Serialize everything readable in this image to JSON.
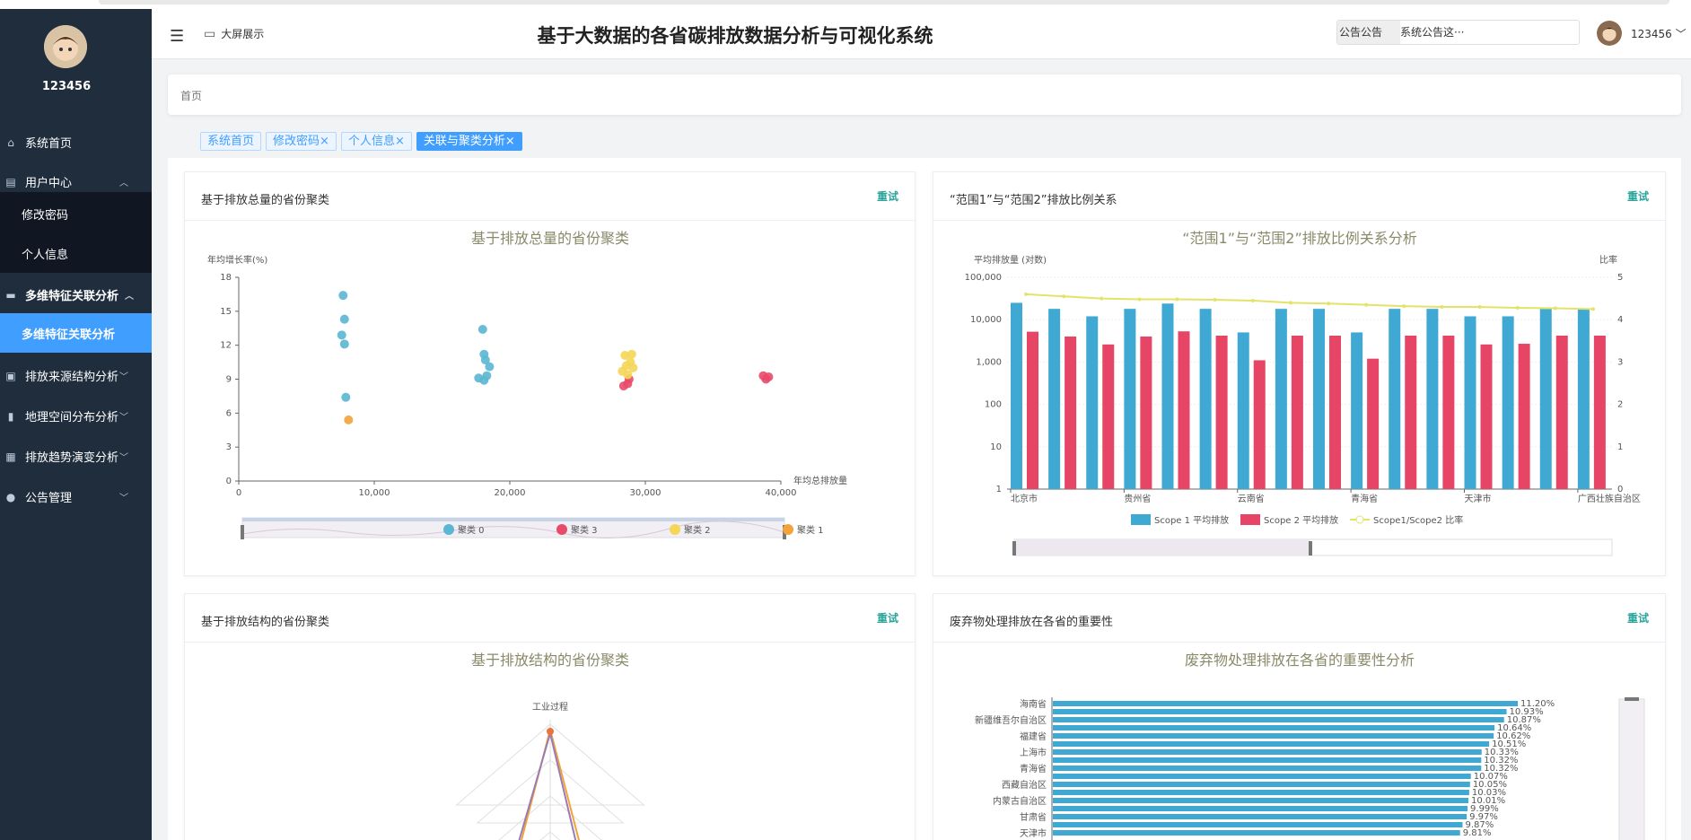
{
  "header": {
    "bigscreen_label": "大屏展示",
    "title": "基于大数据的各省碳排放数据分析与可视化系统",
    "notice_label": "公告公告",
    "notice_text": "系统公告这···",
    "username": "123456"
  },
  "sidebar": {
    "username": "123456",
    "items": [
      {
        "label": "系统首页",
        "icon": "home-icon"
      },
      {
        "label": "用户中心",
        "icon": "user-center-icon"
      },
      {
        "label": "修改密码"
      },
      {
        "label": "个人信息"
      },
      {
        "label": "多维特征关联分析",
        "icon": "monitor-icon"
      },
      {
        "label": "多维特征关联分析"
      },
      {
        "label": "排放来源结构分析",
        "icon": "clipboard-icon"
      },
      {
        "label": "地理空间分布分析",
        "icon": "bar-chart-icon"
      },
      {
        "label": "排放趋势演变分析",
        "icon": "grid-icon"
      },
      {
        "label": "公告管理",
        "icon": "person-icon"
      }
    ]
  },
  "breadcrumb": "首页",
  "tabs": [
    {
      "label": "系统首页"
    },
    {
      "label": "修改密码",
      "close": "×"
    },
    {
      "label": "个人信息",
      "close": "×"
    },
    {
      "label": "关联与聚类分析",
      "close": "×"
    }
  ],
  "panels": {
    "p1": {
      "title": "基于排放总量的省份聚类",
      "retry": "重试"
    },
    "p2": {
      "title": "“范围1”与“范围2”排放比例关系",
      "retry": "重试"
    },
    "p3": {
      "title": "基于排放结构的省份聚类",
      "retry": "重试"
    },
    "p4": {
      "title": "废弃物处理排放在各省的重要性",
      "retry": "重试"
    }
  },
  "chart_data": [
    {
      "type": "scatter",
      "title": "基于排放总量的省份聚类",
      "xlabel": "年均总排放量",
      "ylabel": "年均增长率(%)",
      "xlim": [
        0,
        40000
      ],
      "ylim": [
        0,
        18
      ],
      "xticks": [
        "0",
        "10,000",
        "20,000",
        "30,000",
        "40,000"
      ],
      "yticks": [
        "0",
        "3",
        "6",
        "9",
        "12",
        "15",
        "18"
      ],
      "legend": [
        "聚类 0",
        "聚类 3",
        "聚类 2",
        "聚类 1"
      ],
      "colors": {
        "聚类 0": "#5bb6d3",
        "聚类 3": "#e84a6a",
        "聚类 2": "#f5d657",
        "聚类 1": "#f2a33a"
      },
      "series": [
        {
          "name": "聚类 0",
          "points": [
            [
              7700,
              16.4
            ],
            [
              7800,
              14.3
            ],
            [
              7600,
              12.9
            ],
            [
              7800,
              12.1
            ],
            [
              7900,
              7.4
            ],
            [
              18000,
              13.4
            ],
            [
              18100,
              11.2
            ],
            [
              18200,
              10.7
            ],
            [
              18500,
              10.1
            ],
            [
              17700,
              9.1
            ],
            [
              18100,
              8.9
            ],
            [
              18300,
              9.3
            ]
          ]
        },
        {
          "name": "聚类 3",
          "points": [
            [
              28400,
              8.4
            ],
            [
              28700,
              8.6
            ],
            [
              28800,
              9.0
            ],
            [
              38700,
              9.3
            ],
            [
              38900,
              9.0
            ],
            [
              39100,
              9.2
            ]
          ]
        },
        {
          "name": "聚类 2",
          "points": [
            [
              28500,
              11.1
            ],
            [
              29000,
              11.2
            ],
            [
              28600,
              10.2
            ],
            [
              28900,
              10.5
            ],
            [
              28300,
              9.7
            ],
            [
              29100,
              10.0
            ],
            [
              28700,
              9.4
            ]
          ]
        },
        {
          "name": "聚类 1",
          "points": [
            [
              8100,
              5.4
            ]
          ]
        }
      ]
    },
    {
      "type": "bar",
      "title": "“范围1”与“范围2”排放比例关系分析",
      "ylabel": "平均排放量 (对数)",
      "y2label": "比率",
      "yticks": [
        "1",
        "10",
        "100",
        "1,000",
        "10,000",
        "100,000"
      ],
      "y2ticks": [
        "0",
        "1",
        "2",
        "3",
        "4",
        "5"
      ],
      "xticklabels": [
        "北京市",
        "贵州省",
        "云南省",
        "青海省",
        "天津市",
        "广西壮族自治区"
      ],
      "legend": [
        "Scope 1 平均排放",
        "Scope 2 平均排放",
        "Scope1/Scope2 比率"
      ],
      "colors": {
        "Scope 1": "#3fa9d3",
        "Scope 2": "#e64566",
        "ratio": "#e3e36a"
      },
      "scope1": [
        25000,
        18000,
        12000,
        18000,
        24000,
        18000,
        5000,
        18000,
        18000,
        5000,
        18000,
        18000,
        12000,
        12000,
        18000,
        18000
      ],
      "scope2": [
        5200,
        4000,
        2600,
        4000,
        5300,
        4200,
        1100,
        4200,
        4200,
        1200,
        4200,
        4200,
        2600,
        2700,
        4200,
        4200
      ],
      "ratio": [
        4.6,
        4.55,
        4.5,
        4.48,
        4.48,
        4.47,
        4.45,
        4.4,
        4.38,
        4.35,
        4.32,
        4.3,
        4.3,
        4.28,
        4.27,
        4.25
      ]
    },
    {
      "type": "radar",
      "title": "基于排放结构的省份聚类",
      "axis_label_top": "工业过程"
    },
    {
      "type": "bar",
      "title": "废弃物处理排放在各省的重要性分析",
      "categories": [
        "海南省",
        "",
        "新疆维吾尔自治区",
        "",
        "福建省",
        "",
        "上海市",
        "",
        "青海省",
        "",
        "西藏自治区",
        "",
        "内蒙古自治区",
        "",
        "甘肃省",
        "",
        "天津市"
      ],
      "values": [
        11.2,
        10.93,
        10.87,
        10.64,
        10.62,
        10.51,
        10.33,
        10.32,
        10.32,
        10.07,
        10.05,
        10.03,
        10.01,
        9.99,
        9.97,
        9.87,
        9.81
      ],
      "value_labels": [
        "11.20%",
        "10.93%",
        "10.87%",
        "10.64%",
        "10.62%",
        "10.51%",
        "10.33%",
        "10.32%",
        "10.32%",
        "10.07%",
        "10.05%",
        "10.03%",
        "10.01%",
        "9.99%",
        "9.97%",
        "9.87%",
        "9.81%"
      ]
    }
  ]
}
